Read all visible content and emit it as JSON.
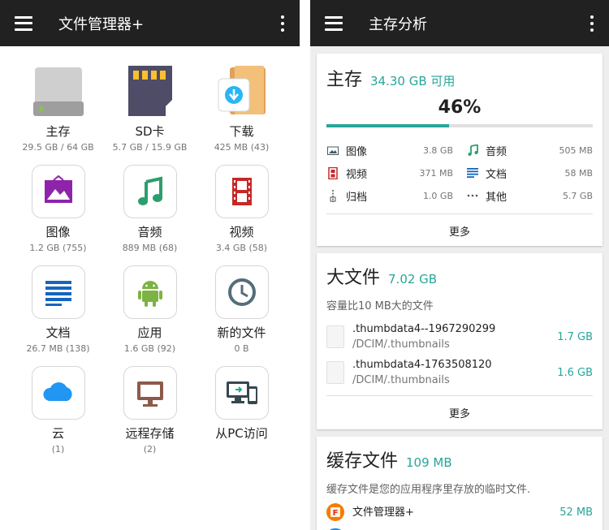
{
  "left": {
    "title": "文件管理器+",
    "items": [
      {
        "label": "主存",
        "sub": "29.5 GB / 64 GB",
        "icon": "drive-icon"
      },
      {
        "label": "SD卡",
        "sub": "5.7 GB / 15.9 GB",
        "icon": "sd-card-icon"
      },
      {
        "label": "下载",
        "sub": "425 MB (43)",
        "icon": "download-folder-icon"
      },
      {
        "label": "图像",
        "sub": "1.2 GB (755)",
        "icon": "image-icon"
      },
      {
        "label": "音频",
        "sub": "889 MB (68)",
        "icon": "music-note-icon"
      },
      {
        "label": "视频",
        "sub": "3.4 GB (58)",
        "icon": "film-icon"
      },
      {
        "label": "文档",
        "sub": "26.7 MB (138)",
        "icon": "document-icon"
      },
      {
        "label": "应用",
        "sub": "1.6 GB (92)",
        "icon": "android-icon"
      },
      {
        "label": "新的文件",
        "sub": "0 B",
        "icon": "clock-icon"
      },
      {
        "label": "云",
        "sub": "(1)",
        "icon": "cloud-icon"
      },
      {
        "label": "远程存储",
        "sub": "(2)",
        "icon": "monitor-icon"
      },
      {
        "label": "从PC访问",
        "sub": "",
        "icon": "pc-phone-icon"
      }
    ]
  },
  "right": {
    "title": "主存分析",
    "storage": {
      "title": "主存",
      "free": "34.30 GB 可用",
      "percent_label": "46%",
      "percent": 46,
      "left_rows": [
        {
          "name": "图像",
          "value": "3.8 GB",
          "icon": "image-icon"
        },
        {
          "name": "视频",
          "value": "371 MB",
          "icon": "film-icon"
        },
        {
          "name": "归档",
          "value": "1.0 GB",
          "icon": "archive-icon"
        }
      ],
      "right_rows": [
        {
          "name": "音频",
          "value": "505 MB",
          "icon": "music-note-icon"
        },
        {
          "name": "文档",
          "value": "58 MB",
          "icon": "document-icon"
        },
        {
          "name": "其他",
          "value": "5.7 GB",
          "icon": "more-horizontal-icon"
        }
      ],
      "more": "更多"
    },
    "large": {
      "title": "大文件",
      "size": "7.02 GB",
      "desc": "容量比10 MB大的文件",
      "files": [
        {
          "name": ".thumbdata4--1967290299",
          "path": "/DCIM/.thumbnails",
          "size": "1.7 GB"
        },
        {
          "name": ".thumbdata4-1763508120",
          "path": "/DCIM/.thumbnails",
          "size": "1.6 GB"
        }
      ],
      "more": "更多"
    },
    "cache": {
      "title": "缓存文件",
      "size": "109 MB",
      "desc": "缓存文件是您的应用程序里存放的临时文件.",
      "apps": [
        {
          "name": "文件管理器+",
          "size": "52 MB"
        }
      ]
    }
  },
  "colors": {
    "accent": "#26a69a",
    "appbar": "#212121"
  }
}
